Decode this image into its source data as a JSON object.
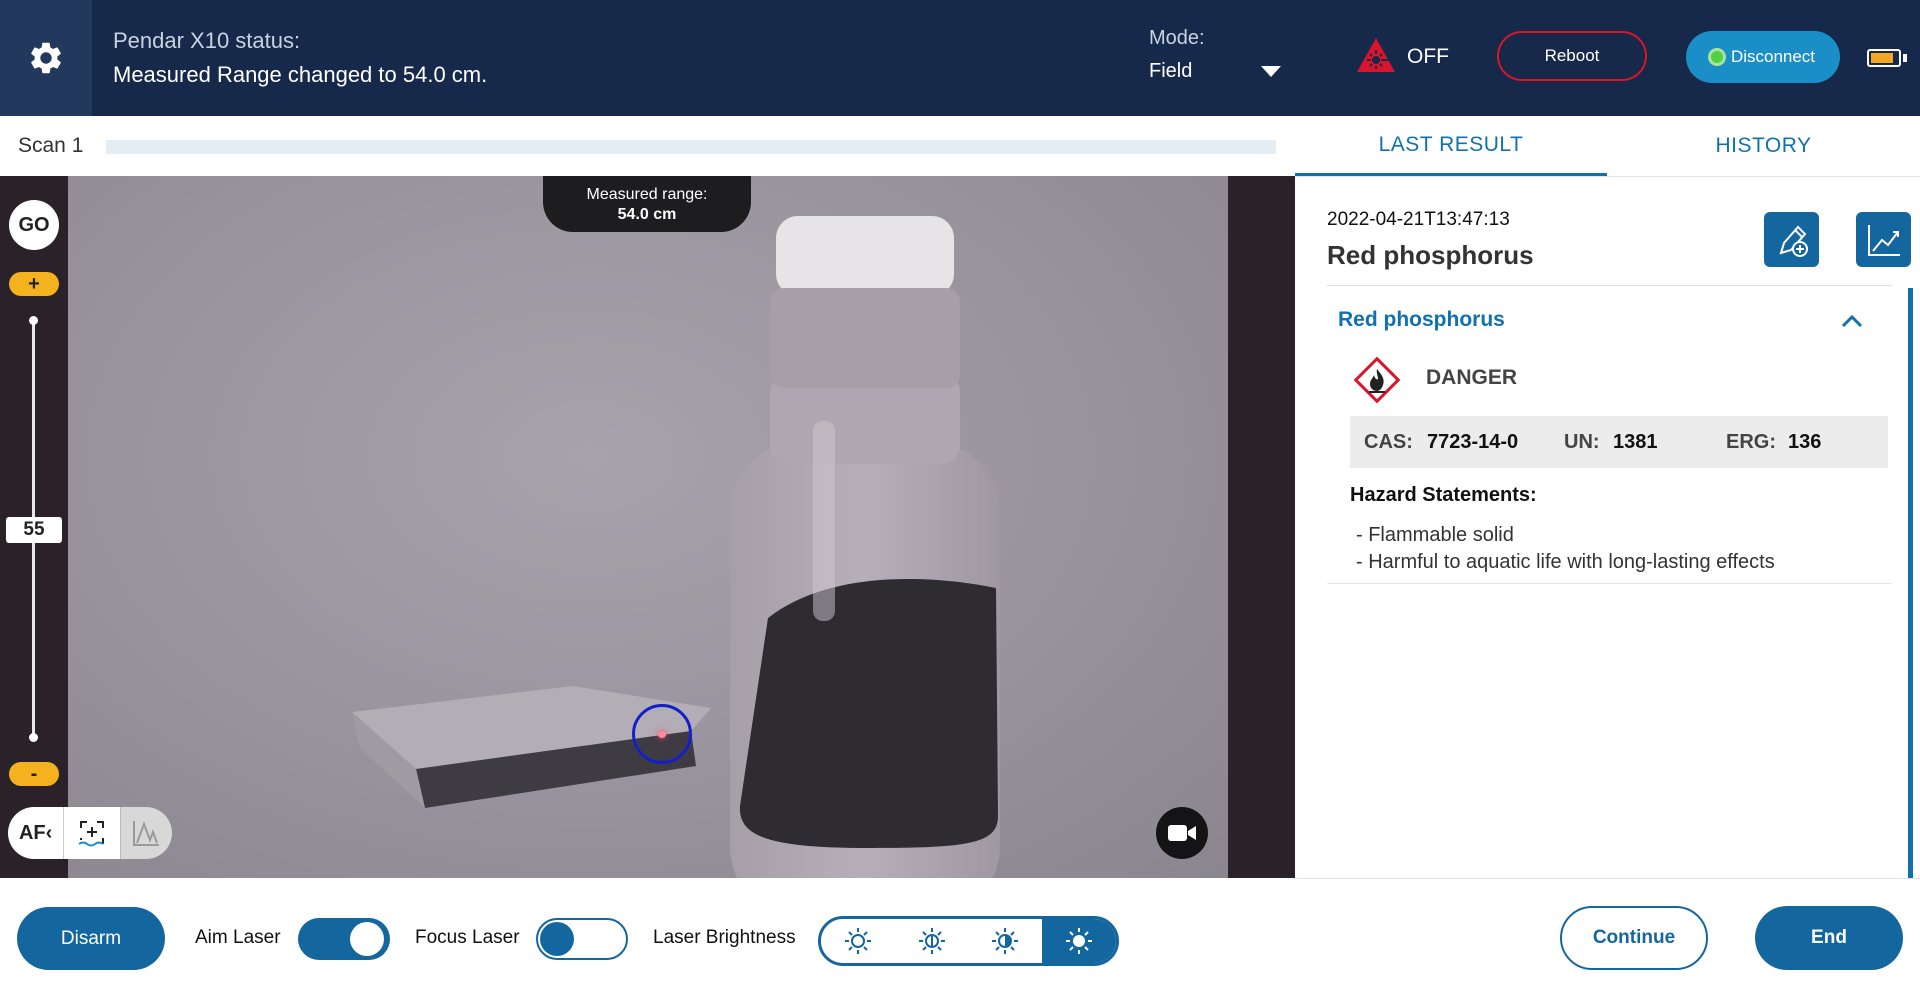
{
  "header": {
    "status_title": "Pendar X10 status:",
    "status_message": "Measured Range changed to 54.0 cm.",
    "mode_label": "Mode:",
    "mode_value": "Field",
    "laser_state": "OFF",
    "reboot_label": "Reboot",
    "disconnect_label": "Disconnect",
    "battery_level": 0.85,
    "colors": {
      "header_bg": "#16294a",
      "danger_red": "#d9142b",
      "connect_blue": "#1a8fc7",
      "connected_green": "#53d145",
      "battery": "#f5a623"
    }
  },
  "scan": {
    "label": "Scan 1",
    "progress": 0
  },
  "tabs": [
    {
      "label": "LAST RESULT",
      "active": true
    },
    {
      "label": "HISTORY",
      "active": false
    }
  ],
  "camera": {
    "go_label": "GO",
    "zoom_plus": "+",
    "zoom_minus": "-",
    "zoom_value": "55",
    "range_title": "Measured range:",
    "range_value": "54.0 cm",
    "af_label": "AF‹",
    "icons": [
      "video-camera-icon",
      "camera-icon",
      "focus-target-icon",
      "spectrum-icon"
    ]
  },
  "result": {
    "timestamp": "2022-04-21T13:47:13",
    "name": "Red phosphorus",
    "compound": "Red phosphorus",
    "signal_word": "DANGER",
    "cas_label": "CAS:",
    "cas": "7723-14-0",
    "un_label": "UN:",
    "un": "1381",
    "erg_label": "ERG:",
    "erg": "136",
    "hazard_title": "Hazard Statements:",
    "hazards": [
      "- Flammable solid",
      "- Harmful to aquatic life with long-lasting effects"
    ],
    "accent_color": "#1171b0"
  },
  "controls": {
    "disarm_label": "Disarm",
    "aim_laser_label": "Aim Laser",
    "aim_laser_on": true,
    "focus_laser_label": "Focus Laser",
    "focus_laser_on": false,
    "brightness_label": "Laser Brightness",
    "brightness_level": 4,
    "continue_label": "Continue",
    "end_label": "End",
    "button_color": "#14669f"
  }
}
